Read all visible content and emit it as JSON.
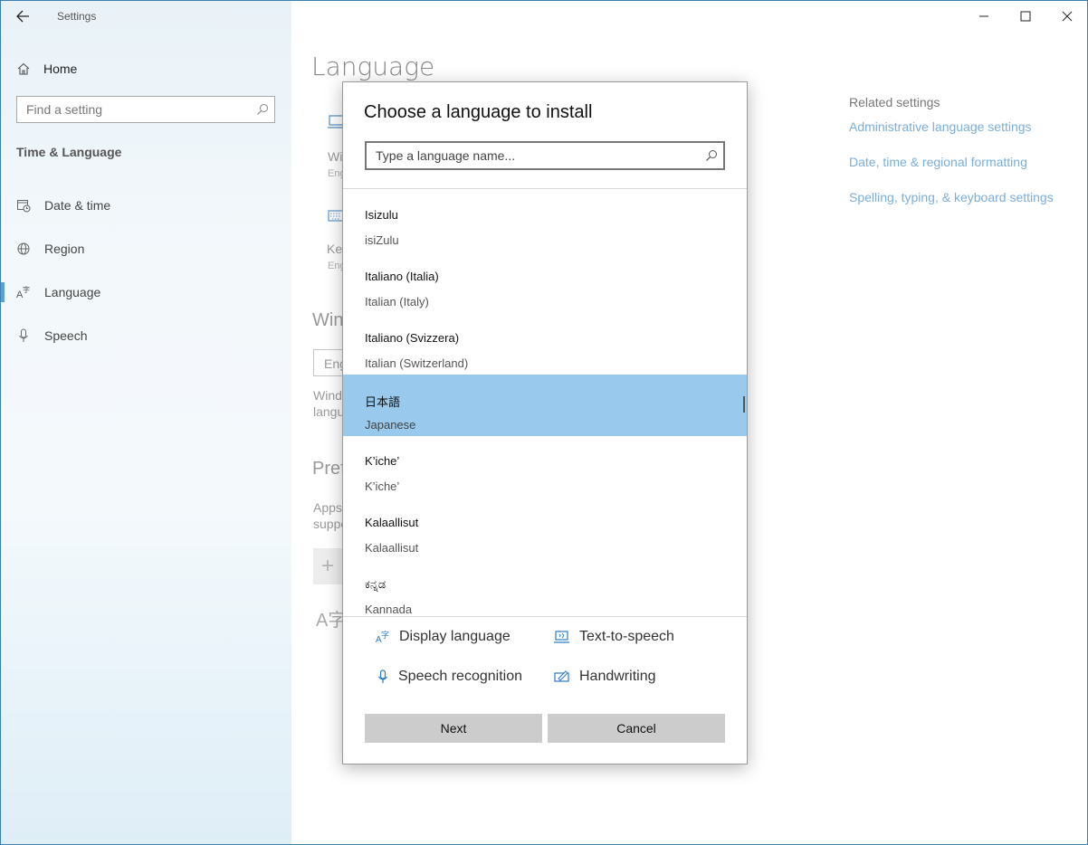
{
  "window": {
    "title": "Settings"
  },
  "sidebar": {
    "home_label": "Home",
    "search_placeholder": "Find a setting",
    "section_title": "Time & Language",
    "items": [
      {
        "label": "Date & time",
        "icon": "calendar-clock-icon"
      },
      {
        "label": "Region",
        "icon": "globe-icon"
      },
      {
        "label": "Language",
        "icon": "language-icon",
        "active": true
      },
      {
        "label": "Speech",
        "icon": "microphone-icon"
      }
    ]
  },
  "main": {
    "page_title": "Language",
    "bg_fragments": {
      "display_label": "Wi",
      "display_sub": "Eng",
      "keyboard_label": "Key",
      "keyboard_sub": "Eng",
      "windows_heading": "Win",
      "dropdown_value": "Eng",
      "windows_desc_1": "Wind",
      "windows_desc_2": "langu",
      "preferred_heading": "Pref",
      "apps_desc_1": "Apps",
      "apps_desc_2": "suppo",
      "add_glyph": "+",
      "lang_glyph": "A字"
    }
  },
  "related": {
    "title": "Related settings",
    "links": [
      "Administrative language settings",
      "Date, time & regional formatting",
      "Spelling, typing, & keyboard settings"
    ]
  },
  "dialog": {
    "title": "Choose a language to install",
    "search_placeholder": "Type a language name...",
    "languages": [
      {
        "native": "Isizulu",
        "english": "isiZulu",
        "selected": false
      },
      {
        "native": "Italiano (Italia)",
        "english": "Italian (Italy)",
        "selected": false
      },
      {
        "native": "Italiano (Svizzera)",
        "english": "Italian (Switzerland)",
        "selected": false
      },
      {
        "native": "日本語",
        "english": "Japanese",
        "selected": true
      },
      {
        "native": "K’iche’",
        "english": "K’iche’",
        "selected": false
      },
      {
        "native": "Kalaallisut",
        "english": "Kalaallisut",
        "selected": false
      },
      {
        "native": "ಕನ್ನಡ",
        "english": "Kannada",
        "selected": false
      }
    ],
    "features": {
      "display_language": "Display language",
      "text_to_speech": "Text-to-speech",
      "speech_recognition": "Speech recognition",
      "handwriting": "Handwriting"
    },
    "next_label": "Next",
    "cancel_label": "Cancel"
  },
  "colors": {
    "accent": "#0078d7",
    "selected_row": "#99c9ec",
    "link": "#7aaedb"
  }
}
